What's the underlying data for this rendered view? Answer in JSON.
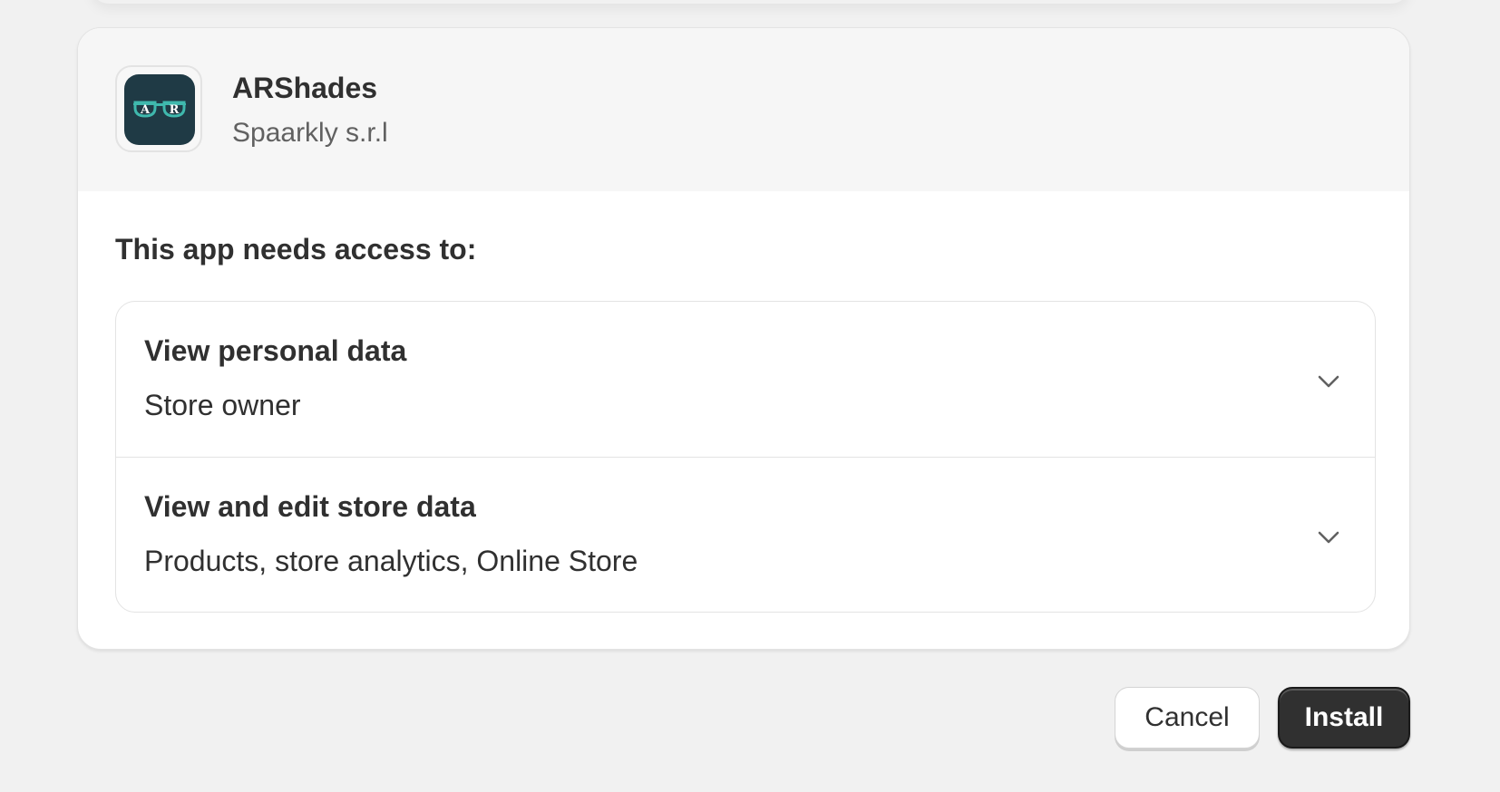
{
  "app": {
    "name": "ARShades",
    "developer": "Spaarkly s.r.l",
    "icon": "glasses-logo-icon",
    "icon_letters": [
      "A",
      "R"
    ],
    "icon_bg": "#1f3a45",
    "icon_accent": "#3fb8ad"
  },
  "access": {
    "title": "This app needs access to:",
    "permissions": [
      {
        "title": "View personal data",
        "description": "Store owner",
        "icon": "chevron-down-icon"
      },
      {
        "title": "View and edit store data",
        "description": "Products, store analytics, Online Store",
        "icon": "chevron-down-icon"
      }
    ]
  },
  "actions": {
    "cancel_label": "Cancel",
    "install_label": "Install"
  }
}
